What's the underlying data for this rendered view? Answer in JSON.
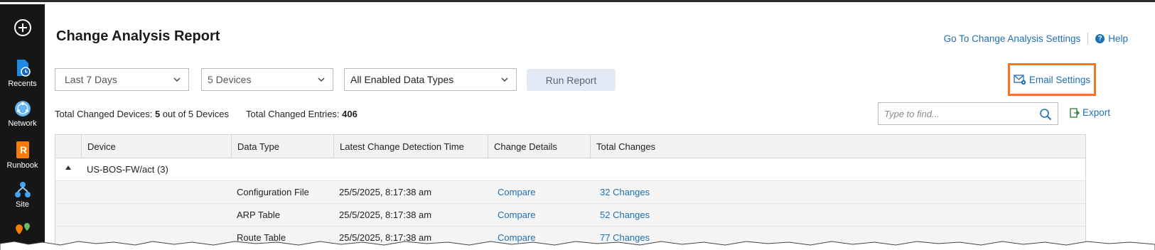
{
  "sidebar": {
    "items": [
      {
        "label": "Recents",
        "icon": "recents-icon"
      },
      {
        "label": "Network",
        "icon": "network-icon"
      },
      {
        "label": "Runbook",
        "icon": "runbook-icon"
      },
      {
        "label": "Site",
        "icon": "site-icon"
      }
    ],
    "top_icon": "add-circle-icon",
    "bottom_icon": "map-pin-icon"
  },
  "header": {
    "title": "Change Analysis Report",
    "settings_link": "Go To Change Analysis Settings",
    "help_link": "Help"
  },
  "filters": {
    "time_range": "Last 7 Days",
    "devices": "5 Devices",
    "data_types": "All Enabled Data Types",
    "run_button": "Run Report"
  },
  "email_settings": "Email Settings",
  "summary": {
    "devices_label": "Total Changed Devices:",
    "devices_count": "5",
    "devices_suffix": "out of 5 Devices",
    "entries_label": "Total Changed Entries:",
    "entries_count": "406"
  },
  "search": {
    "placeholder": "Type to find..."
  },
  "export_label": "Export",
  "table": {
    "columns": [
      "Device",
      "Data Type",
      "Latest Change Detection Time",
      "Change Details",
      "Total Changes"
    ],
    "group": "US-BOS-FW/act (3)",
    "rows": [
      {
        "data_type": "Configuration File",
        "time": "25/5/2025, 8:17:38 am",
        "details": "Compare",
        "changes": "32 Changes"
      },
      {
        "data_type": "ARP Table",
        "time": "25/5/2025, 8:17:38 am",
        "details": "Compare",
        "changes": "52 Changes"
      },
      {
        "data_type": "Route Table",
        "time": "25/5/2025, 8:17:38 am",
        "details": "Compare",
        "changes": "77 Changes"
      }
    ]
  },
  "colors": {
    "accent": "#1f6fb2",
    "highlight": "#f0782a",
    "rail": "#161616"
  }
}
